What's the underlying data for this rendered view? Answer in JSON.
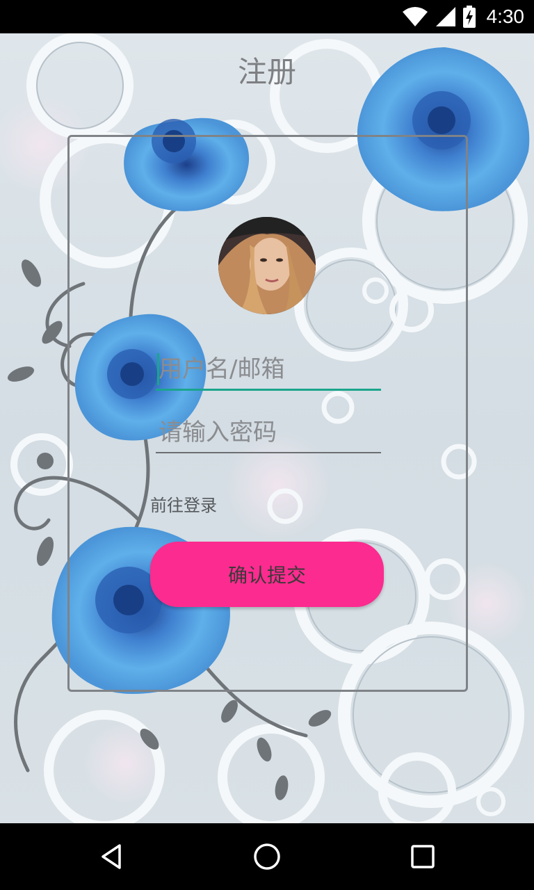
{
  "status_bar": {
    "time": "4:30",
    "icons": [
      "wifi-icon",
      "signal-icon",
      "battery-charging-icon"
    ]
  },
  "page": {
    "title": "注册"
  },
  "form": {
    "avatar": "profile-avatar",
    "username_placeholder": "用户名/邮箱",
    "password_placeholder": "请输入密码",
    "login_link": "前往登录",
    "submit_label": "确认提交"
  },
  "colors": {
    "accent": "#1aa58c",
    "button": "#fc2b8f",
    "title": "#7d7f82"
  },
  "nav_bar": {
    "buttons": [
      "back-icon",
      "home-icon",
      "recents-icon"
    ]
  }
}
